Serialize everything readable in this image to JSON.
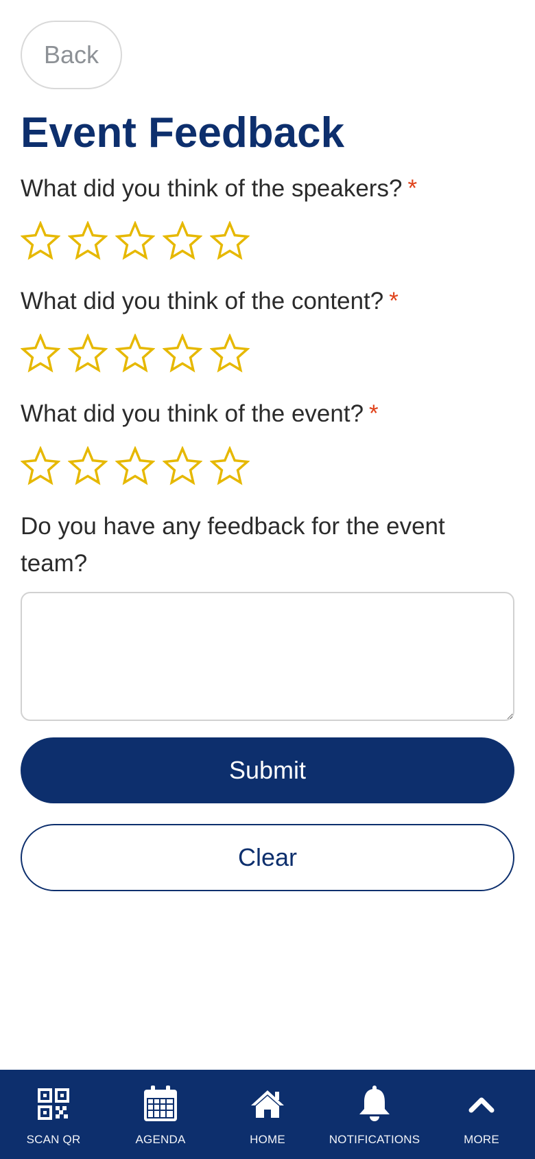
{
  "header": {
    "back_label": "Back",
    "title": "Event Feedback"
  },
  "form": {
    "questions": [
      {
        "label": "What did you think of the speakers?",
        "required_mark": "*",
        "rating": 0,
        "max_rating": 5
      },
      {
        "label": "What did you think of the content?",
        "required_mark": "*",
        "rating": 0,
        "max_rating": 5
      },
      {
        "label": "What did you think of the event?",
        "required_mark": "*",
        "rating": 0,
        "max_rating": 5
      }
    ],
    "feedback_label": "Do you have any feedback for the event team?",
    "feedback_value": "",
    "submit_label": "Submit",
    "clear_label": "Clear"
  },
  "nav": {
    "items": [
      {
        "label": "SCAN QR",
        "icon": "qr-code-icon"
      },
      {
        "label": "AGENDA",
        "icon": "calendar-icon"
      },
      {
        "label": "HOME",
        "icon": "home-icon"
      },
      {
        "label": "NOTIFICATIONS",
        "icon": "bell-icon"
      },
      {
        "label": "MORE",
        "icon": "chevron-up-icon"
      }
    ]
  },
  "colors": {
    "brand_navy": "#0d2f6d",
    "star_gold": "#e6b800",
    "required_red": "#e0431b",
    "text": "#2b2b2b"
  }
}
